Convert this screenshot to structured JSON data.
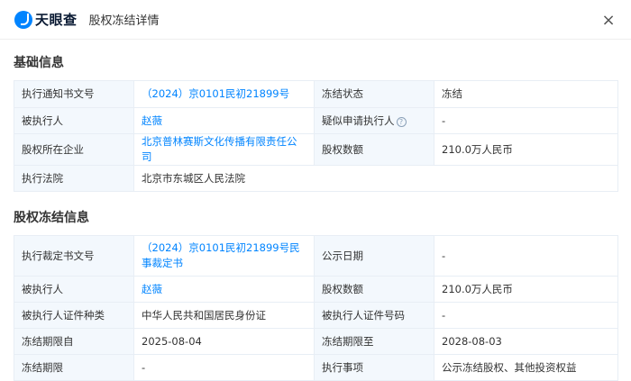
{
  "header": {
    "logo_text": "天眼查",
    "title": "股权冻结详情",
    "close_glyph": "×"
  },
  "basic": {
    "title": "基础信息",
    "rows": [
      [
        "执行通知书文号",
        "（2024）京0101民初21899号",
        "冻结状态",
        "冻结"
      ],
      [
        "被执行人",
        "赵薇",
        "疑似申请执行人",
        "-"
      ],
      [
        "股权所在企业",
        "北京普林赛斯文化传播有限责任公司",
        "股权数额",
        "210.0万人民币"
      ],
      [
        "执行法院",
        "北京市东城区人民法院"
      ]
    ],
    "help_glyph": "?"
  },
  "freeze": {
    "title": "股权冻结信息",
    "rows": [
      [
        "执行裁定书文号",
        "（2024）京0101民初21899号民事裁定书",
        "公示日期",
        "-"
      ],
      [
        "被执行人",
        "赵薇",
        "股权数额",
        "210.0万人民币"
      ],
      [
        "被执行人证件种类",
        "中华人民共和国居民身份证",
        "被执行人证件号码",
        "-"
      ],
      [
        "冻结期限自",
        "2025-08-04",
        "冻结期限至",
        "2028-08-03"
      ],
      [
        "冻结期限",
        "-",
        "执行事项",
        "公示冻结股权、其他投资权益"
      ]
    ]
  }
}
